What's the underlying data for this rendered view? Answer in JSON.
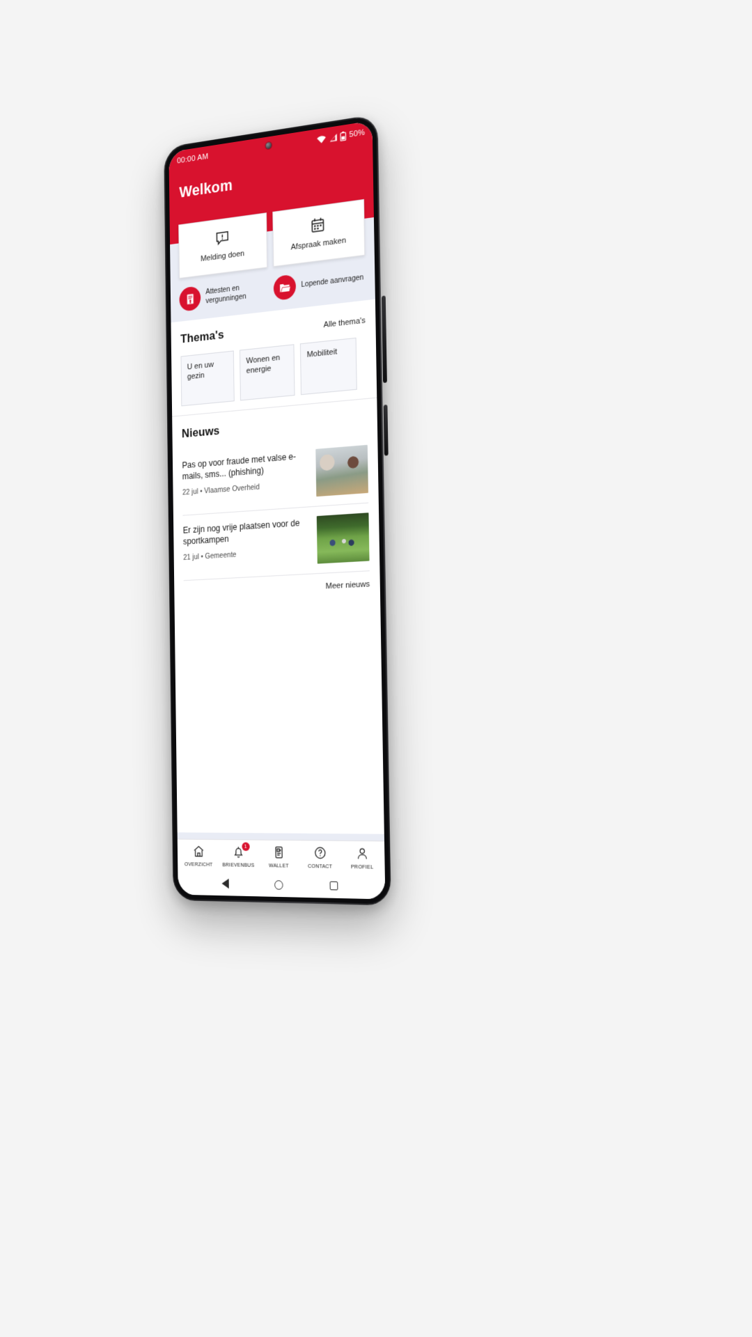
{
  "colors": {
    "brand": "#D8122E",
    "quick_bg": "#E9ECF5",
    "page_bg": "#F4F4F4"
  },
  "statusbar": {
    "time": "00:00 AM",
    "battery_percent": "50%",
    "icons": [
      "wifi-icon",
      "cellular-signal-icon",
      "battery-icon"
    ]
  },
  "header": {
    "title": "Welkom"
  },
  "quick_actions": {
    "tiles": [
      {
        "label": "Melding doen",
        "icon": "report-message-icon"
      },
      {
        "label": "Afspraak maken",
        "icon": "calendar-icon"
      }
    ],
    "circles": [
      {
        "label": "Attesten en vergunningen",
        "icon": "certificate-icon"
      },
      {
        "label": "Lopende aanvragen",
        "icon": "folder-open-icon"
      }
    ]
  },
  "themes": {
    "title": "Thema's",
    "link": "Alle thema's",
    "chips": [
      "U en uw gezin",
      "Wonen en energie",
      "Mobiliteit"
    ]
  },
  "news": {
    "title": "Nieuws",
    "more_link": "Meer nieuws",
    "items": [
      {
        "title": "Pas op voor fraude met valse e-mails, sms... (phishing)",
        "date": "22 jul",
        "source": "Vlaamse Overheid",
        "meta": "22 jul • Vlaamse Overheid",
        "thumb": "phishing-photo"
      },
      {
        "title": "Er zijn nog  vrije plaatsen voor de sportkampen",
        "date": "21 jul",
        "source": "Gemeente",
        "meta": "21 jul • Gemeente",
        "thumb": "sportcamp-photo"
      }
    ]
  },
  "bottom_nav": {
    "items": [
      {
        "label": "OVERZICHT",
        "icon": "home-icon",
        "badge": ""
      },
      {
        "label": "BRIEVENBUS",
        "icon": "bell-icon",
        "badge": "1"
      },
      {
        "label": "WALLET",
        "icon": "wallet-card-icon",
        "badge": ""
      },
      {
        "label": "CONTACT",
        "icon": "question-circle-icon",
        "badge": ""
      },
      {
        "label": "PROFIEL",
        "icon": "person-icon",
        "badge": ""
      }
    ]
  },
  "system_nav": {
    "back": "back-triangle-icon",
    "home": "home-circle-icon",
    "recents": "recents-square-icon"
  }
}
